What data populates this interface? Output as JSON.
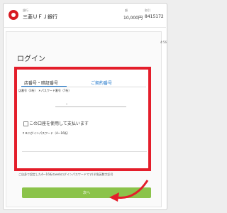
{
  "header": {
    "bank_small_label": "銀行",
    "bank_name": "三菱ＵＦＪ銀行",
    "amount_label": "額",
    "amount": "10,000円",
    "code_label": "取引",
    "code": "8415172",
    "logo_icon": "bank-logo-icon"
  },
  "login": {
    "timer": "4:56",
    "title": "ログイン",
    "tabs": [
      "店番号・暗証番号",
      "ご契約番号"
    ],
    "active_tab_index": 0,
    "field_hint": "店番号（3桁） ＊パスワード番号（7桁）",
    "field_separator": "-",
    "checkbox_label": "この口座を使用して支払います",
    "password_label": "ＩＢログインパスワード（4〜16桁）",
    "note": "ご自身で設定した4〜16桁のwebログインパスワードです(半角英数字記号",
    "next_button": "次へ"
  },
  "annotations": {
    "highlight_color": "#e41e2b",
    "arrow_color": "#e41e2b"
  },
  "colors": {
    "accent_blue": "#1a73c9",
    "button_green": "#8bc34a"
  }
}
